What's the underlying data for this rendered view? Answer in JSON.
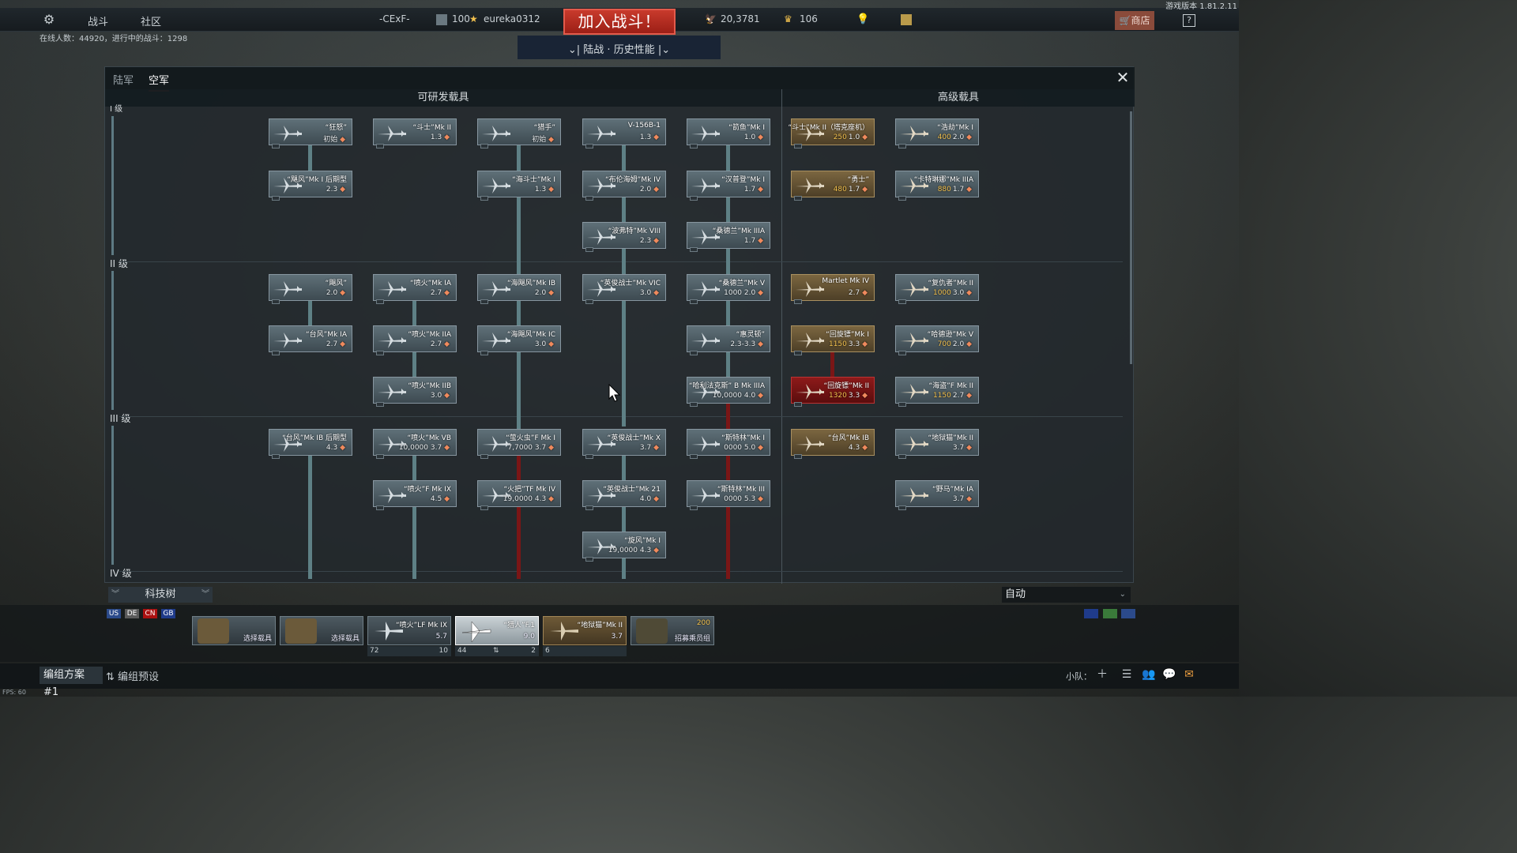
{
  "version": "游戏版本 1.81.2.11",
  "top": {
    "nav": [
      "战斗",
      "社区"
    ],
    "clan_tag": "-CExF-",
    "level": "100",
    "username": "eureka0312",
    "join_label": "加入战斗！",
    "silver": "20,3781",
    "gold": "106",
    "mode": "陆战 · 历史性能",
    "shop": "商店",
    "help": "?",
    "online": "在线人数：44920，进行中的战斗：1298"
  },
  "window": {
    "tabs": [
      "陆军",
      "空军"
    ],
    "active_tab": "空军",
    "research_header": "可研发载具",
    "premium_header": "高级载具",
    "ranks": [
      "I 级",
      "II 级",
      "III 级",
      "IV 级"
    ]
  },
  "cards": [
    {
      "name": "“狂怒”",
      "info": "初始"
    },
    {
      "name": "“斗士”Mk II",
      "info": "1.3"
    },
    {
      "name": "“猎手”",
      "info": "初始"
    },
    {
      "name": "V-156B-1",
      "info": "1.3"
    },
    {
      "name": "“箭鱼”Mk I",
      "info": "1.0"
    },
    {
      "name": "“飓风”Mk I 后期型",
      "info": "2.3"
    },
    {
      "name": "“海斗士”Mk I",
      "info": "1.3"
    },
    {
      "name": "“布伦海姆”Mk IV",
      "info": "2.0"
    },
    {
      "name": "“汉普登”Mk I",
      "info": "1.7"
    },
    {
      "name": "“波弗特”Mk VIII",
      "info": "2.3"
    },
    {
      "name": "“桑德兰”Mk IIIA",
      "info": "1.7"
    },
    {
      "name": "“飓风”",
      "info": "2.0"
    },
    {
      "name": "“喷火”Mk IA",
      "info": "2.7"
    },
    {
      "name": "“海飓风”Mk IB",
      "info": "2.0"
    },
    {
      "name": "“英俊战士”Mk VIC",
      "info": "3.0"
    },
    {
      "name": "“桑德兰”Mk V",
      "info": "1000 2.0"
    },
    {
      "name": "“台风”Mk IA",
      "info": "2.7"
    },
    {
      "name": "“喷火”Mk IIA",
      "info": "2.7"
    },
    {
      "name": "“海飓风”Mk IC",
      "info": "3.0"
    },
    {
      "name": "“惠灵顿”",
      "info": "2.3-3.3"
    },
    {
      "name": "“喷火”Mk IIB",
      "info": "3.0"
    },
    {
      "name": "“哈利法克斯” B Mk IIIA",
      "info": "10,0000 4.0"
    },
    {
      "name": "“台风”Mk IB 后期型",
      "info": "4.3"
    },
    {
      "name": "“喷火”Mk VB",
      "info": "10,0000 3.7"
    },
    {
      "name": "“萤火虫”F Mk I",
      "info": "7,7000 3.7"
    },
    {
      "name": "“英俊战士”Mk X",
      "info": "3.7"
    },
    {
      "name": "“斯特林”Mk I",
      "info": "0000 5.0"
    },
    {
      "name": "“喷火”F Mk IX",
      "info": "4.5"
    },
    {
      "name": "“火把”TF Mk IV",
      "info": "19,0000 4.3"
    },
    {
      "name": "“英俊战士”Mk 21",
      "info": "4.0"
    },
    {
      "name": "“斯特林”Mk III",
      "info": "0000 5.3"
    },
    {
      "name": "“旋风”Mk I",
      "info": "19,0000 4.3"
    }
  ],
  "premium_cards": [
    {
      "name": "“斗士”Mk II（塔克座机）",
      "cost": "250",
      "br": "1.0"
    },
    {
      "name": "“浩劫”Mk I",
      "cost": "400",
      "br": "2.0"
    },
    {
      "name": "“勇士”",
      "cost": "480",
      "br": "1.7"
    },
    {
      "name": "“卡特琳娜”Mk IIIA",
      "cost": "880",
      "br": "1.7"
    },
    {
      "name": "Martlet Mk IV",
      "cost": "",
      "br": "2.7"
    },
    {
      "name": "“复仇者”Mk II",
      "cost": "1000",
      "br": "3.0"
    },
    {
      "name": "“回旋镖”Mk I",
      "cost": "1150",
      "br": "3.3"
    },
    {
      "name": "“哈德逊”Mk V",
      "cost": "700",
      "br": "2.0"
    },
    {
      "name": "“回旋镖”Mk II",
      "cost": "1320",
      "br": "3.3"
    },
    {
      "name": "“海盗”F Mk II",
      "cost": "1150",
      "br": "2.7"
    },
    {
      "name": "“台风”Mk IB",
      "cost": "",
      "br": "4.3"
    },
    {
      "name": "“地狱猫”Mk II",
      "cost": "",
      "br": "3.7"
    },
    {
      "name": "“野马”Mk IA",
      "cost": "",
      "br": "3.7"
    }
  ],
  "bottom": {
    "tech_tree": "科技树",
    "auto": "自动",
    "flags": [
      "US",
      "DE",
      "CN",
      "GB"
    ],
    "slots": [
      {
        "name": "",
        "label": "选择载具"
      },
      {
        "name": "",
        "label": "选择载具"
      },
      {
        "name": "“喷火”LF Mk IX",
        "info": "5.7",
        "sub1": "72",
        "sub2": "10"
      },
      {
        "name": "“猎人”F.1",
        "info": "9.0",
        "sub1": "44",
        "sub2": "2"
      },
      {
        "name": "“地狱猫”Mk II",
        "info": "3.7",
        "sub1": "6",
        "sub2": ""
      },
      {
        "name": "200",
        "label": "招募乘员组"
      }
    ],
    "preset": "编组方案 #1",
    "preset_edit": "编组预设",
    "squad": "小队：",
    "fps": "FPS: 60"
  },
  "colors": {
    "join": "#c83a2c",
    "line": "#5e8085",
    "red_line": "#7a1616",
    "premium": "#7b6640"
  }
}
